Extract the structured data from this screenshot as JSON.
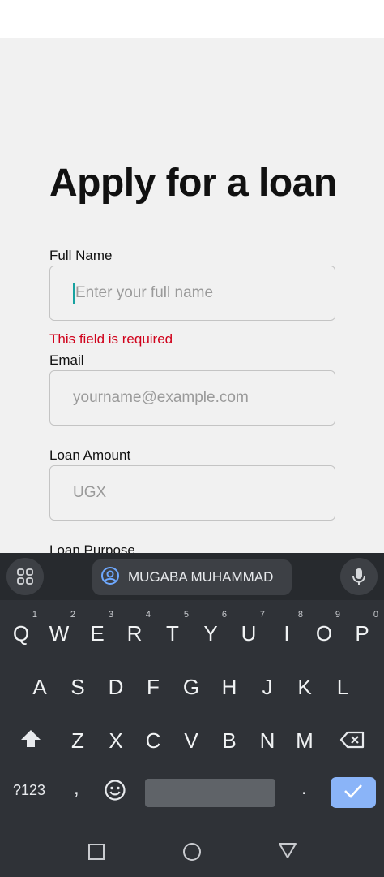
{
  "form": {
    "title": "Apply for a loan",
    "full_name": {
      "label": "Full Name",
      "placeholder": "Enter your full name",
      "error": "This field is required"
    },
    "email": {
      "label": "Email",
      "placeholder": "yourname@example.com"
    },
    "loan_amount": {
      "label": "Loan Amount",
      "placeholder": "UGX"
    },
    "loan_purpose": {
      "label": "Loan Purpose"
    }
  },
  "keyboard": {
    "suggestion": "MUGABA MUHAMMAD",
    "row1": [
      {
        "letter": "Q",
        "num": "1"
      },
      {
        "letter": "W",
        "num": "2"
      },
      {
        "letter": "E",
        "num": "3"
      },
      {
        "letter": "R",
        "num": "4"
      },
      {
        "letter": "T",
        "num": "5"
      },
      {
        "letter": "Y",
        "num": "6"
      },
      {
        "letter": "U",
        "num": "7"
      },
      {
        "letter": "I",
        "num": "8"
      },
      {
        "letter": "O",
        "num": "9"
      },
      {
        "letter": "P",
        "num": "0"
      }
    ],
    "row2": [
      "A",
      "S",
      "D",
      "F",
      "G",
      "H",
      "J",
      "K",
      "L"
    ],
    "row3": [
      "Z",
      "X",
      "C",
      "V",
      "B",
      "N",
      "M"
    ],
    "symbols_label": "?123",
    "comma": ",",
    "period": "."
  },
  "icons": {
    "apps": "apps-grid-icon",
    "account": "account-circle-icon",
    "mic": "microphone-icon",
    "shift": "shift-icon",
    "backspace": "backspace-icon",
    "emoji": "emoji-icon",
    "enter": "checkmark-icon",
    "recents": "square-icon",
    "home": "circle-icon",
    "back": "triangle-icon"
  },
  "colors": {
    "error": "#d0021b",
    "caret": "#17a2a0",
    "enter_key": "#8ab4f8",
    "keyboard_bg": "#2f3237"
  }
}
